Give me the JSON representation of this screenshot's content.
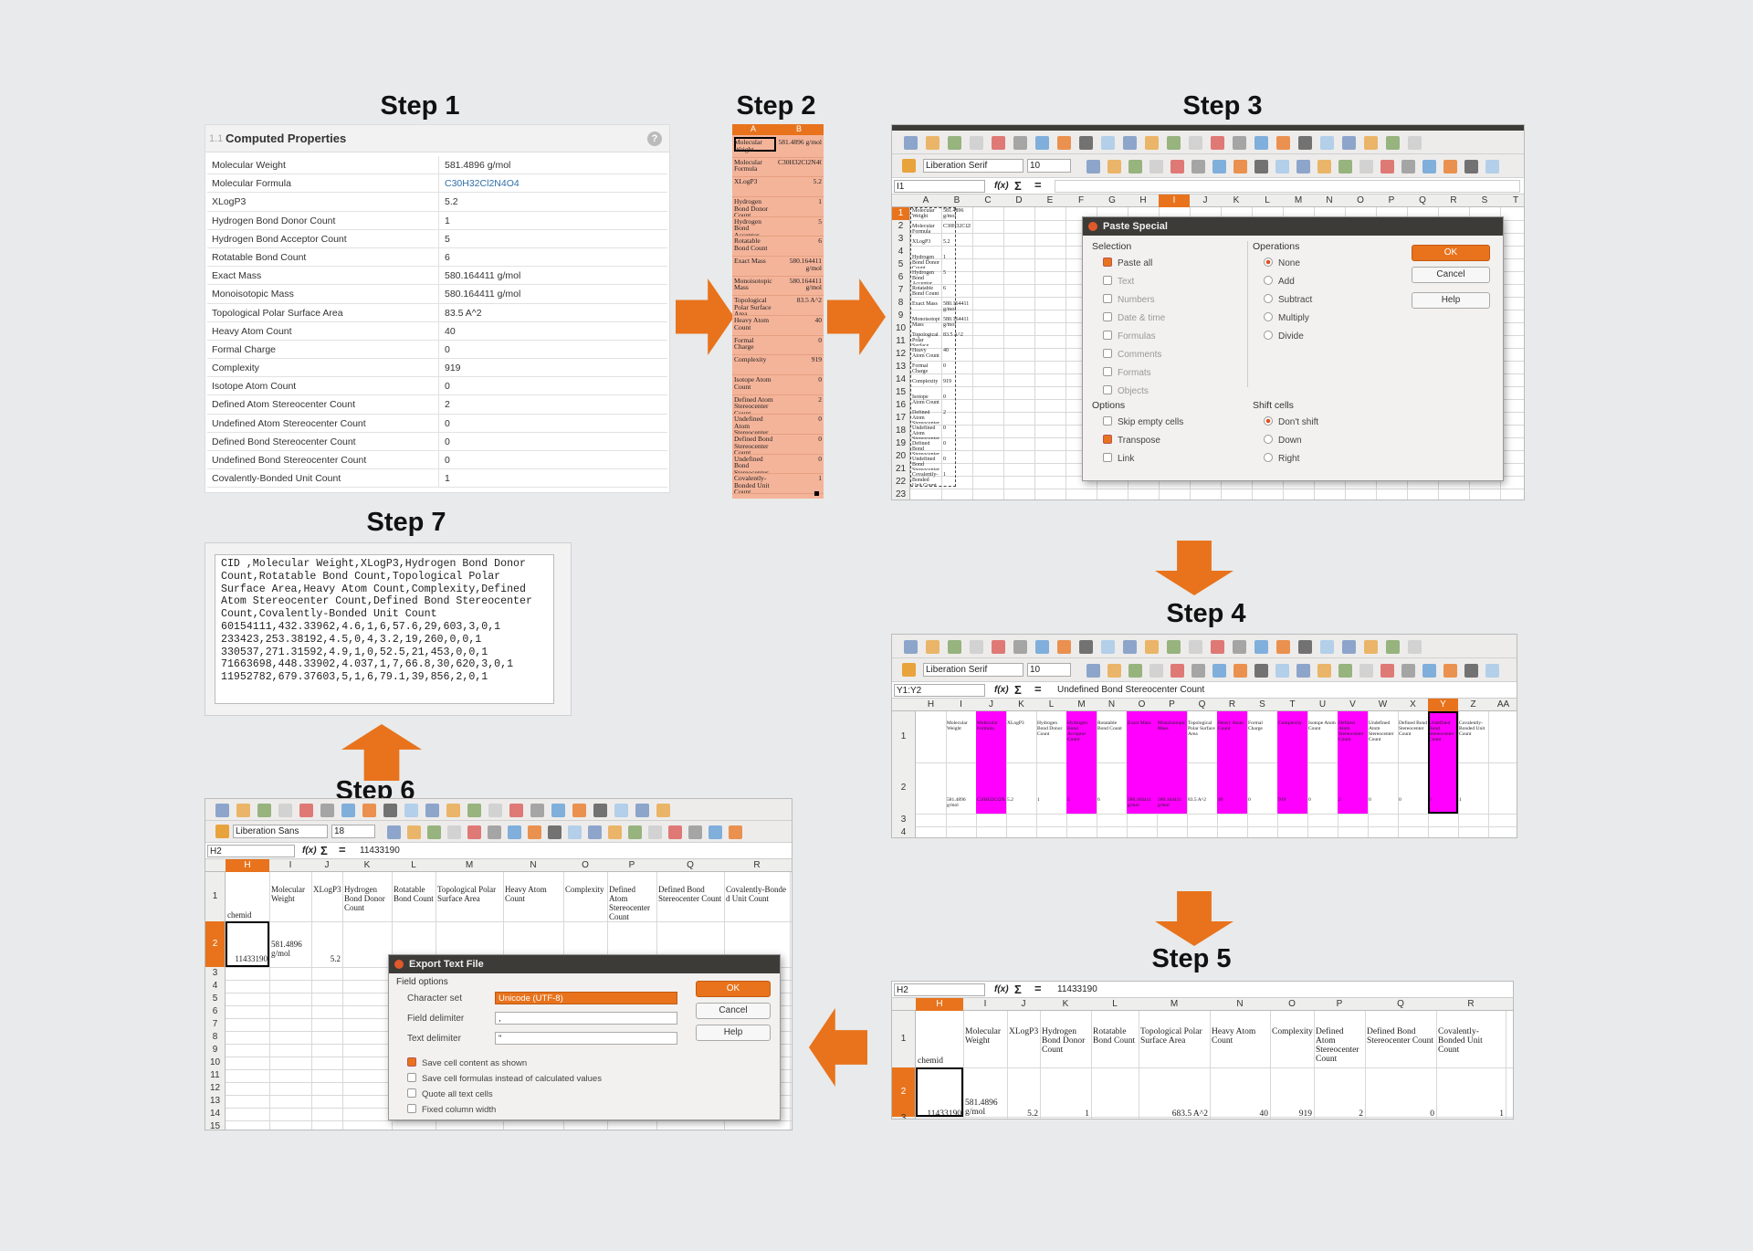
{
  "steps": {
    "step1": "Step 1",
    "step2": "Step 2",
    "step3": "Step 3",
    "step4": "Step 4",
    "step5": "Step 5",
    "step6": "Step 6",
    "step7": "Step 7"
  },
  "colors": {
    "accent": "#e8731c",
    "highlight": "#ff00ff",
    "selection": "#f4b49a"
  },
  "computed": {
    "num": "1.1",
    "title": "Computed Properties",
    "help": "?",
    "rows": [
      {
        "k": "Molecular Weight",
        "v": "581.4896 g/mol"
      },
      {
        "k": "Molecular Formula",
        "v": "C30H32Cl2N4O4"
      },
      {
        "k": "XLogP3",
        "v": "5.2"
      },
      {
        "k": "Hydrogen Bond Donor Count",
        "v": "1"
      },
      {
        "k": "Hydrogen Bond Acceptor Count",
        "v": "5"
      },
      {
        "k": "Rotatable Bond Count",
        "v": "6"
      },
      {
        "k": "Exact Mass",
        "v": "580.164411 g/mol"
      },
      {
        "k": "Monoisotopic Mass",
        "v": "580.164411 g/mol"
      },
      {
        "k": "Topological Polar Surface Area",
        "v": "83.5 A^2"
      },
      {
        "k": "Heavy Atom Count",
        "v": "40"
      },
      {
        "k": "Formal Charge",
        "v": "0"
      },
      {
        "k": "Complexity",
        "v": "919"
      },
      {
        "k": "Isotope Atom Count",
        "v": "0"
      },
      {
        "k": "Defined Atom Stereocenter Count",
        "v": "2"
      },
      {
        "k": "Undefined Atom Stereocenter Count",
        "v": "0"
      },
      {
        "k": "Defined Bond Stereocenter Count",
        "v": "0"
      },
      {
        "k": "Undefined Bond Stereocenter Count",
        "v": "0"
      },
      {
        "k": "Covalently-Bonded Unit Count",
        "v": "1"
      }
    ]
  },
  "step2": {
    "colA": "A",
    "colB": "B"
  },
  "toolbar": {
    "font": "Liberation Serif",
    "size": "10",
    "font6": "Liberation Sans",
    "size6": "18",
    "fx": "f(x)",
    "sum": "Σ",
    "eq": "="
  },
  "step3": {
    "namebox": "I1",
    "cols": [
      "A",
      "B",
      "C",
      "D",
      "E",
      "F",
      "G",
      "H",
      "I",
      "J",
      "K",
      "L",
      "M",
      "N",
      "O",
      "P",
      "Q",
      "R",
      "S",
      "T"
    ],
    "rows": [
      "1",
      "2",
      "3",
      "4",
      "5",
      "6",
      "7",
      "8",
      "9",
      "10",
      "11",
      "12",
      "13",
      "14",
      "15",
      "16",
      "17",
      "18",
      "19",
      "20",
      "21",
      "22",
      "23"
    ],
    "dialog": {
      "title": "Paste Special",
      "selection": "Selection",
      "sel_items": [
        "Paste all",
        "Text",
        "Numbers",
        "Date & time",
        "Formulas",
        "Comments",
        "Formats",
        "Objects"
      ],
      "operations": "Operations",
      "ops": [
        "None",
        "Add",
        "Subtract",
        "Multiply",
        "Divide"
      ],
      "options": "Options",
      "opt_items": [
        "Skip empty cells",
        "Transpose",
        "Link"
      ],
      "shift": "Shift cells",
      "shift_items": [
        "Don't shift",
        "Down",
        "Right"
      ],
      "ok": "OK",
      "cancel": "Cancel",
      "help": "Help"
    }
  },
  "step4": {
    "namebox": "Y1:Y2",
    "formula": "Undefined Bond Stereocenter Count",
    "cols": [
      "H",
      "I",
      "J",
      "K",
      "L",
      "M",
      "N",
      "O",
      "P",
      "Q",
      "R",
      "S",
      "T",
      "U",
      "V",
      "W",
      "X",
      "Y",
      "Z",
      "AA"
    ],
    "rows": [
      "1",
      "2",
      "3",
      "4"
    ]
  },
  "step5": {
    "namebox": "H2",
    "formula": "11433190",
    "cols": [
      "H",
      "I",
      "J",
      "K",
      "L",
      "M",
      "N",
      "O",
      "P",
      "Q",
      "R"
    ],
    "headers": [
      "chemid",
      "Molecular Weight",
      "XLogP3",
      "Hydrogen Bond Donor Count",
      "Rotatable Bond Count",
      "Topological Polar Surface Area",
      "Heavy Atom Count",
      "Complexity",
      "Defined Atom Stereocenter Count",
      "Defined Bond Stereocenter Count",
      "Covalently-Bonded Unit Count"
    ],
    "values": [
      "11433190",
      "581.4896 g/mol",
      "5.2",
      "1",
      "",
      "683.5 A^2",
      "40",
      "919",
      "2",
      "0",
      "1"
    ],
    "rows": [
      "1",
      "2",
      "3"
    ]
  },
  "step6": {
    "namebox": "H2",
    "formula": "11433190",
    "cols": [
      "H",
      "I",
      "J",
      "K",
      "L",
      "M",
      "N",
      "O",
      "P",
      "Q",
      "R"
    ],
    "headers": [
      "chemid",
      "Molecular Weight",
      "XLogP3",
      "Hydrogen Bond Donor Count",
      "Rotatable Bond Count",
      "Topological Polar Surface Area",
      "Heavy Atom Count",
      "Complexity",
      "Defined Atom Stereocenter Count",
      "Defined Bond Stereocenter Count",
      "Covalently-Bonde d Unit Count"
    ],
    "values": [
      "11433190",
      "581.4896 g/mol",
      "5.2"
    ],
    "rows": [
      "1",
      "2",
      "3",
      "4",
      "5",
      "6",
      "7",
      "8",
      "9",
      "10",
      "11",
      "12",
      "13",
      "14",
      "15"
    ],
    "dialog": {
      "title": "Export Text File",
      "field_options": "Field options",
      "charset_label": "Character set",
      "charset": "Unicode (UTF-8)",
      "field_delim_label": "Field delimiter",
      "field_delim": ",",
      "text_delim_label": "Text delimiter",
      "text_delim": "\"",
      "checks": [
        "Save cell content as shown",
        "Save cell formulas instead of calculated values",
        "Quote all text cells",
        "Fixed column width"
      ],
      "ok": "OK",
      "cancel": "Cancel",
      "help": "Help"
    }
  },
  "step7": {
    "csv": "CID ,Molecular Weight,XLogP3,Hydrogen Bond Donor\nCount,Rotatable Bond Count,Topological Polar\nSurface Area,Heavy Atom Count,Complexity,Defined\nAtom Stereocenter Count,Defined Bond Stereocenter\nCount,Covalently-Bonded Unit Count\n60154111,432.33962,4.6,1,6,57.6,29,603,3,0,1\n233423,253.38192,4.5,0,4,3.2,19,260,0,0,1\n330537,271.31592,4.9,1,0,52.5,21,453,0,0,1\n71663698,448.33902,4.037,1,7,66.8,30,620,3,0,1\n11952782,679.37603,5,1,6,79.1,39,856,2,0,1"
  }
}
